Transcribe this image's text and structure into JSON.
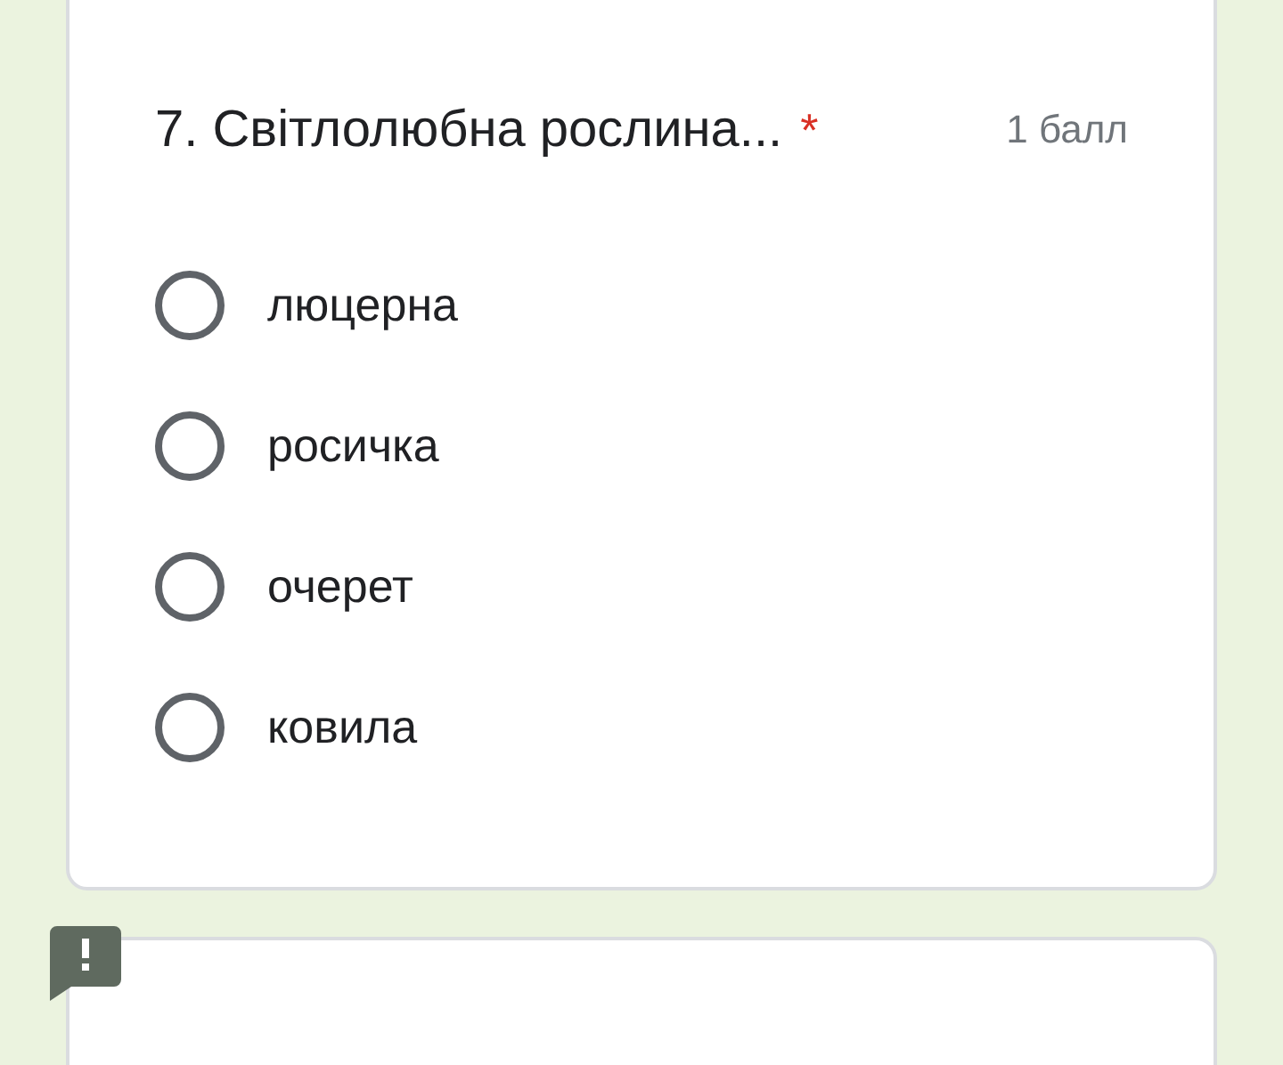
{
  "questions": [
    {
      "title": "7. Світлолюбна рослина...",
      "required_mark": "*",
      "points": "1 балл",
      "flagged": false,
      "options": [
        {
          "label": "люцерна",
          "selected": false
        },
        {
          "label": "росичка",
          "selected": false
        },
        {
          "label": "очерет",
          "selected": false
        },
        {
          "label": "ковила",
          "selected": false
        }
      ]
    },
    {
      "flagged": true
    }
  ]
}
